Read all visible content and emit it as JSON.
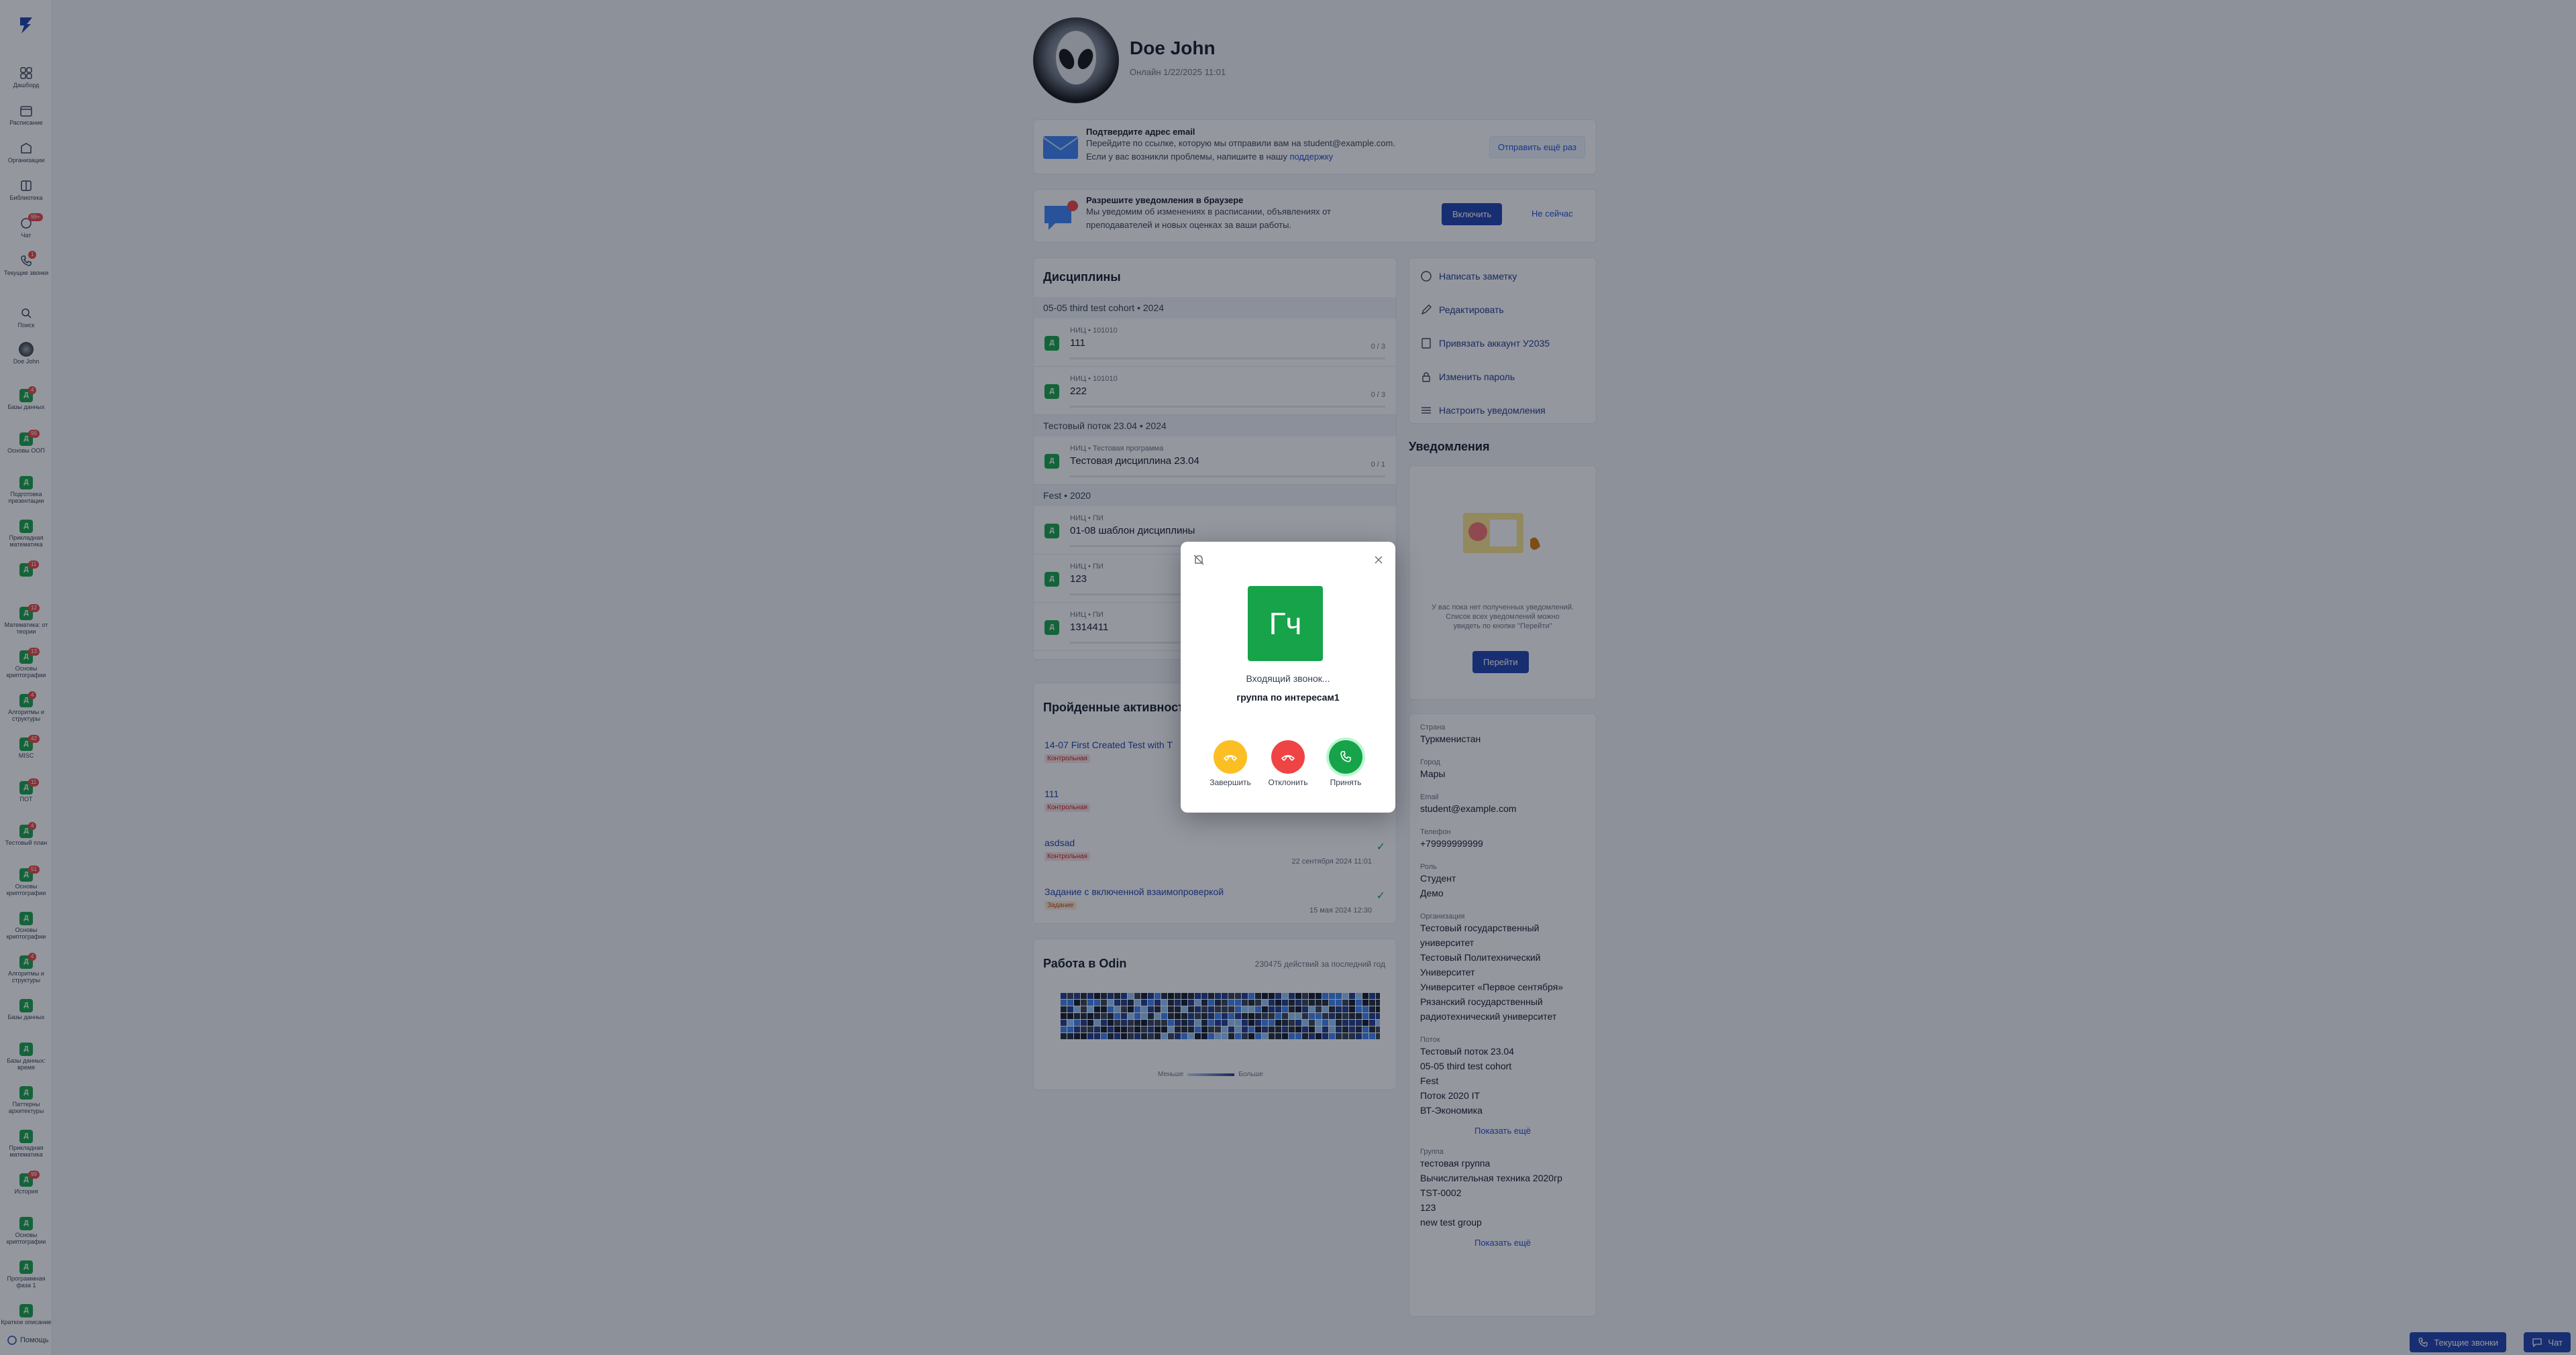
{
  "sidebar": {
    "items": [
      {
        "label": "Дашборд",
        "icon": "dashboard-icon"
      },
      {
        "label": "Расписание",
        "icon": "calendar-icon"
      },
      {
        "label": "Организации",
        "icon": "building-icon"
      },
      {
        "label": "Библиотека",
        "icon": "book-icon"
      },
      {
        "label": "Чат",
        "icon": "chat-icon",
        "badge": "99+"
      },
      {
        "label": "Текущие звонки",
        "icon": "phone-icon",
        "badge": "1"
      },
      {
        "label": "Поиск",
        "icon": "search-icon"
      },
      {
        "label": "Doe John",
        "icon": "avatar-icon"
      }
    ],
    "courses": [
      {
        "label": "Базы данных",
        "badge": "4"
      },
      {
        "label": "Основы ООП",
        "badge": "99"
      },
      {
        "label": "Подготовка презентации",
        "badge": ""
      },
      {
        "label": "Прикладная математика",
        "badge": ""
      },
      {
        "label": "",
        "badge": "11"
      },
      {
        "label": "Математика: от теории",
        "badge": "12"
      },
      {
        "label": "Основы криптографии",
        "badge": "13"
      },
      {
        "label": "Алгоритмы и структуры",
        "badge": "4"
      },
      {
        "label": "MISC",
        "badge": "42"
      },
      {
        "label": "ПОТ",
        "badge": "11"
      },
      {
        "label": "Тестовый план",
        "badge": "4"
      },
      {
        "label": "Основы криптографии",
        "badge": "51"
      },
      {
        "label": "Основы криптографии",
        "badge": ""
      },
      {
        "label": "Алгоритмы и структуры",
        "badge": "4"
      },
      {
        "label": "Базы данных",
        "badge": ""
      },
      {
        "label": "Базы данных: время",
        "badge": ""
      },
      {
        "label": "Паттерны архитектуры",
        "badge": ""
      },
      {
        "label": "Прикладная математика",
        "badge": ""
      },
      {
        "label": "История",
        "badge": "99"
      },
      {
        "label": "Основы криптографии",
        "badge": ""
      },
      {
        "label": "Программная фаза 1",
        "badge": ""
      },
      {
        "label": "Краткое описание",
        "badge": ""
      }
    ],
    "help": "Помощь"
  },
  "profile": {
    "name": "Doe John",
    "online": "Онлайн 1/22/2025 11:01"
  },
  "email_banner": {
    "title": "Подтвердите адрес email",
    "line1": "Перейдите по ссылке, которую мы отправили вам на student@example.com.",
    "line2": "Если у вас возникли проблемы, напишите в нашу",
    "link": "поддержку",
    "button": "Отправить ещё раз"
  },
  "notify_banner": {
    "title": "Разрешите уведомления в браузере",
    "line1": "Мы уведомим об изменениях в расписании, объявлениях от",
    "line2": "преподавателей и новых оценках за ваши работы.",
    "badge": "1",
    "enable": "Включить",
    "later": "Не сейчас"
  },
  "disciplines": {
    "title": "Дисциплины",
    "groups": [
      {
        "name": "05-05 third test cohort • 2024",
        "rows": [
          {
            "sub": "НИЦ • 101010",
            "name": "111",
            "count": "0 / 3"
          },
          {
            "sub": "НИЦ • 101010",
            "name": "222",
            "count": "0 / 3"
          }
        ]
      },
      {
        "name": "Тестовый поток 23.04 • 2024",
        "rows": [
          {
            "sub": "НИЦ • Тестовая программа",
            "name": "Тестовая дисциплина 23.04",
            "count": "0 / 1"
          }
        ]
      },
      {
        "name": "Fest • 2020",
        "rows": [
          {
            "sub": "НИЦ • ПИ",
            "name": "01-08 шаблон дисциплины",
            "count": ""
          },
          {
            "sub": "НИЦ • ПИ",
            "name": "123",
            "count": ""
          },
          {
            "sub": "НИЦ • ПИ",
            "name": "1314411",
            "count": ""
          }
        ]
      }
    ]
  },
  "activities": {
    "title": "Пройденные активности",
    "items": [
      {
        "title": "14-07 First Created Test with T",
        "tag": "Контрольная",
        "tag_color": "red",
        "date": ""
      },
      {
        "title": "111",
        "tag": "Контрольная",
        "tag_color": "red",
        "date": ""
      },
      {
        "title": "asdsad",
        "tag": "Контрольная",
        "tag_color": "red",
        "date": "22 сентября 2024 11:01"
      },
      {
        "title": "Задание с включенной взаимопроверкой",
        "tag": "Задание",
        "tag_color": "orange",
        "date": "15 мая 2024 12:30"
      }
    ]
  },
  "work": {
    "title": "Работа в Odin",
    "subtitle": "230475 действий за последний год",
    "less": "Меньше",
    "more": "Больше"
  },
  "actions": [
    {
      "label": "Написать заметку",
      "icon": "note-icon"
    },
    {
      "label": "Редактировать",
      "icon": "pencil-icon"
    },
    {
      "label": "Привязать аккаунт У2035",
      "icon": "link-icon"
    },
    {
      "label": "Изменить пароль",
      "icon": "lock-icon"
    },
    {
      "label": "Настроить уведомления",
      "icon": "sliders-icon"
    }
  ],
  "notifications": {
    "title": "Уведомления",
    "empty1": "У вас пока нет полученных уведомлений.",
    "empty2": "Список всех уведомлений можно",
    "empty3": "увидеть по кнопке \"Перейти\"",
    "button": "Перейти"
  },
  "info": {
    "country_label": "Страна",
    "country": "Туркменистан",
    "city_label": "Город",
    "city": "Мары",
    "email_label": "Email",
    "email": "student@example.com",
    "phone_label": "Телефон",
    "phone": "+79999999999",
    "role_label": "Роль",
    "roles": [
      "Студент",
      "Демо"
    ],
    "org_label": "Организация",
    "orgs": [
      "Тестовый государственный",
      "университет",
      "Тестовый Политехнический",
      "Университет",
      "Университет «Первое сентября»",
      "Рязанский государственный",
      "радиотехнический университет"
    ],
    "streams_label": "Поток",
    "streams": [
      "Тестовый поток 23.04",
      "05-05 third test cohort",
      "Fest",
      "Поток 2020 IT",
      "ВТ-Экономика"
    ],
    "show_more": "Показать ещё",
    "groups_label": "Группа",
    "groups": [
      "тестовая группа",
      "Вычислительная техника 2020гр",
      "TST-0002",
      "123",
      "new test group"
    ],
    "show_more2": "Показать ещё"
  },
  "call": {
    "initials": "Гч",
    "status": "Входящий звонок...",
    "name": "группа по интересам1",
    "finish": "Завершить",
    "decline": "Отклонить",
    "accept": "Принять"
  },
  "bottom": {
    "calls": "Текущие звонки",
    "chat": "Чат"
  }
}
